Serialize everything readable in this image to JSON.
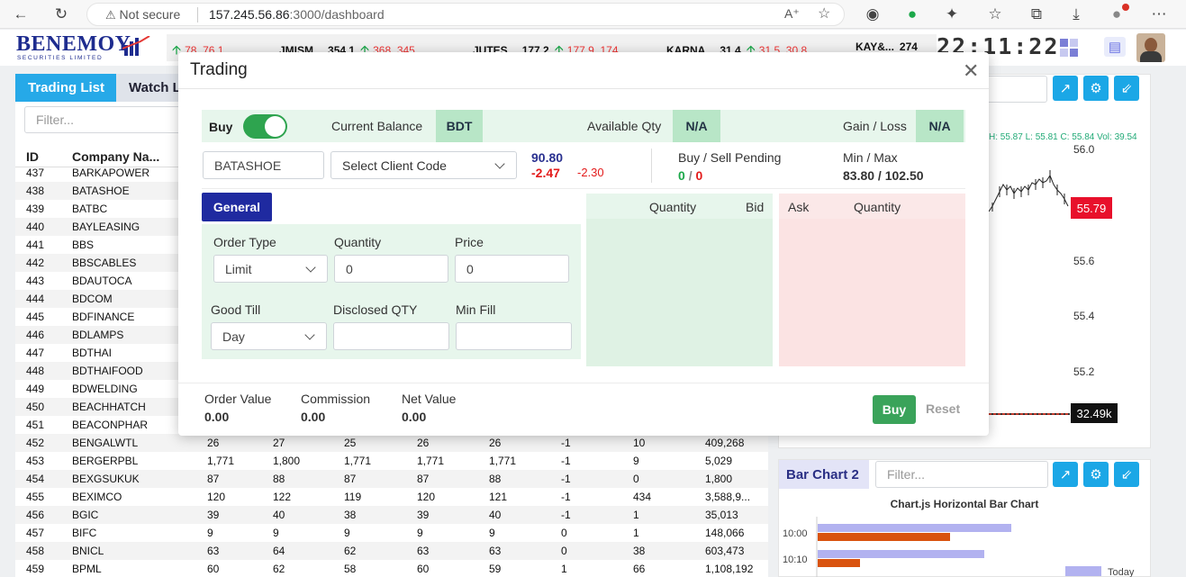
{
  "browser": {
    "not_secure": "Not secure",
    "url_host": "157.245.56.86",
    "url_path": ":3000/dashboard"
  },
  "header": {
    "logo_main": "BENEMOY",
    "logo_sub": "SECURITIES LIMITED",
    "clock": "22:11:22",
    "ticker": [
      {
        "name": "",
        "v1": "78",
        "v2": "76.1"
      },
      {
        "name": "JMISM...",
        "price": "354.1",
        "v1": "368",
        "v2": "345"
      },
      {
        "name": "JUTES...",
        "price": "177.2",
        "v1": "177.9",
        "v2": "174"
      },
      {
        "name": "KARNA...",
        "price": "31.4",
        "v1": "31.5",
        "v2": "30.8"
      },
      {
        "name": "KAY&...",
        "price": "274"
      }
    ]
  },
  "left_panel": {
    "tabs": [
      "Trading List",
      "Watch L"
    ],
    "filter_placeholder": "Filter...",
    "columns": [
      "ID",
      "Company Na..."
    ],
    "rows": [
      {
        "id": "437",
        "name": "BARKAPOWER",
        "c": []
      },
      {
        "id": "438",
        "name": "BATASHOE",
        "c": []
      },
      {
        "id": "439",
        "name": "BATBC",
        "c": []
      },
      {
        "id": "440",
        "name": "BAYLEASING",
        "c": []
      },
      {
        "id": "441",
        "name": "BBS",
        "c": []
      },
      {
        "id": "442",
        "name": "BBSCABLES",
        "c": []
      },
      {
        "id": "443",
        "name": "BDAUTOCA",
        "c": []
      },
      {
        "id": "444",
        "name": "BDCOM",
        "c": []
      },
      {
        "id": "445",
        "name": "BDFINANCE",
        "c": []
      },
      {
        "id": "446",
        "name": "BDLAMPS",
        "c": []
      },
      {
        "id": "447",
        "name": "BDTHAI",
        "c": []
      },
      {
        "id": "448",
        "name": "BDTHAIFOOD",
        "c": []
      },
      {
        "id": "449",
        "name": "BDWELDING",
        "c": []
      },
      {
        "id": "450",
        "name": "BEACHHATCH",
        "c": []
      },
      {
        "id": "451",
        "name": "BEACONPHAR",
        "c": []
      },
      {
        "id": "452",
        "name": "BENGALWTL",
        "c": [
          "26",
          "27",
          "25",
          "26",
          "26",
          "-1",
          "10",
          "409,268"
        ]
      },
      {
        "id": "453",
        "name": "BERGERPBL",
        "c": [
          "1,771",
          "1,800",
          "1,771",
          "1,771",
          "1,771",
          "-1",
          "9",
          "5,029"
        ]
      },
      {
        "id": "454",
        "name": "BEXGSUKUK",
        "c": [
          "87",
          "88",
          "87",
          "87",
          "88",
          "-1",
          "0",
          "1,800"
        ]
      },
      {
        "id": "455",
        "name": "BEXIMCO",
        "c": [
          "120",
          "122",
          "119",
          "120",
          "121",
          "-1",
          "434",
          "3,588,9..."
        ]
      },
      {
        "id": "456",
        "name": "BGIC",
        "c": [
          "39",
          "40",
          "38",
          "39",
          "40",
          "-1",
          "1",
          "35,013"
        ]
      },
      {
        "id": "457",
        "name": "BIFC",
        "c": [
          "9",
          "9",
          "9",
          "9",
          "9",
          "0",
          "1",
          "148,066"
        ]
      },
      {
        "id": "458",
        "name": "BNICL",
        "c": [
          "63",
          "64",
          "62",
          "63",
          "63",
          "0",
          "38",
          "603,473"
        ]
      },
      {
        "id": "459",
        "name": "BPML",
        "c": [
          "60",
          "62",
          "58",
          "60",
          "59",
          "1",
          "66",
          "1,108,192"
        ]
      }
    ]
  },
  "right_panel": {
    "ohlc": {
      "h": "H: 55.87",
      "l": "L: 55.81",
      "c": "C: 55.84",
      "vol": "Vol: 39.54"
    },
    "y_labels": [
      "56.0",
      "55.6",
      "55.4",
      "55.2"
    ],
    "price_tag": "55.79",
    "volume_tag": "32.49k",
    "bar_chart": {
      "title": "Bar Chart 2",
      "filter_placeholder": "Filter...",
      "chart_title": "Chart.js Horizontal Bar Chart",
      "legend": "Today"
    }
  },
  "chart_data": {
    "type": "bar",
    "title": "Chart.js Horizontal Bar Chart",
    "categories": [
      "10:00",
      "10:10"
    ],
    "series": [
      {
        "name": "Today",
        "values": [
          215,
          185
        ]
      },
      {
        "name": "",
        "values": [
          147,
          47
        ]
      }
    ],
    "colors": [
      "#b2b2f0",
      "#d9530f"
    ]
  },
  "modal": {
    "title": "Trading",
    "buy_label": "Buy",
    "current_balance_label": "Current Balance",
    "current_balance": "BDT",
    "available_qty_label": "Available Qty",
    "available_qty": "N/A",
    "gain_loss_label": "Gain / Loss",
    "gain_loss": "N/A",
    "symbol": "BATASHOE",
    "client_placeholder": "Select Client Code",
    "ltp": "90.80",
    "change": "-2.47",
    "change_pct": "-2.30",
    "pending_label": "Buy / Sell Pending",
    "pending_buy": "0",
    "pending_sell": "0",
    "minmax_label": "Min / Max",
    "minmax": "83.80 / 102.50",
    "general_tab": "General",
    "order_type_label": "Order Type",
    "order_type": "Limit",
    "quantity_label": "Quantity",
    "quantity": "0",
    "price_label": "Price",
    "price": "0",
    "good_till_label": "Good Till",
    "good_till": "Day",
    "disclosed_label": "Disclosed QTY",
    "min_fill_label": "Min Fill",
    "bid_headers": [
      "Quantity",
      "Bid"
    ],
    "ask_headers": [
      "Ask",
      "Quantity"
    ],
    "order_value_label": "Order Value",
    "order_value": "0.00",
    "commission_label": "Commission",
    "commission": "0.00",
    "net_value_label": "Net Value",
    "net_value": "0.00",
    "buy_button": "Buy",
    "reset_button": "Reset"
  }
}
